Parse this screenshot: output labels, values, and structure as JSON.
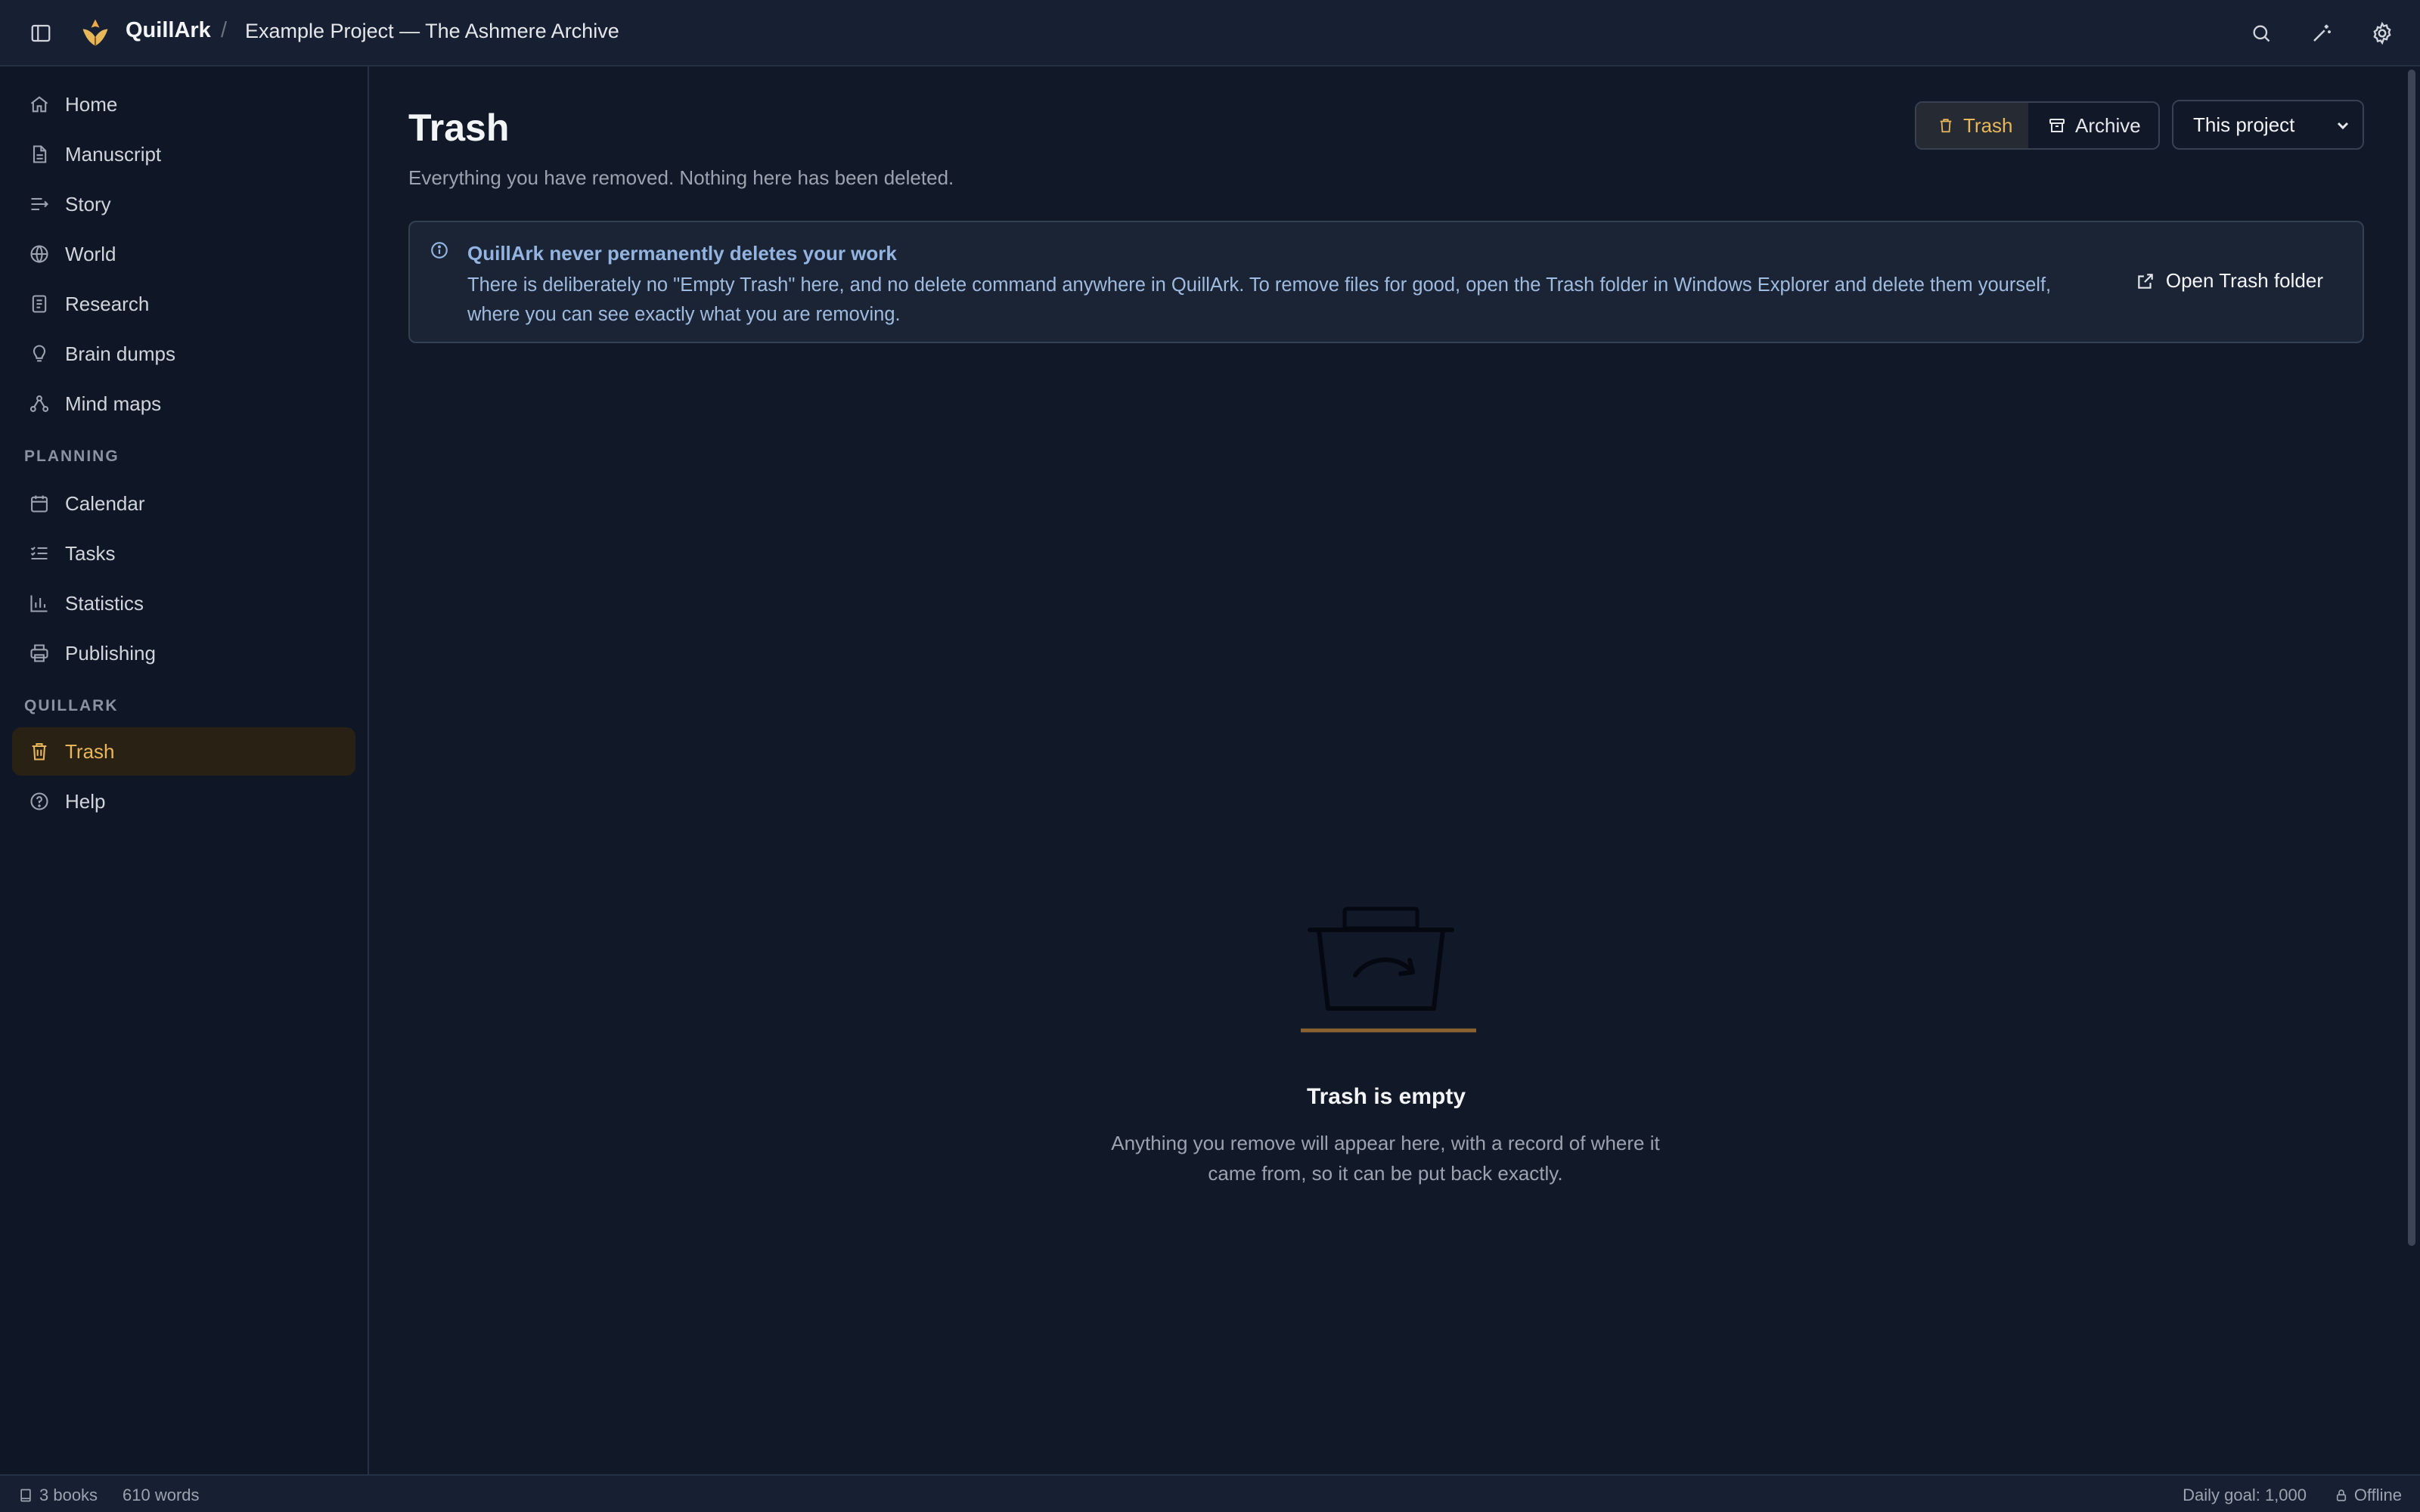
{
  "header": {
    "app_name": "QuillArk",
    "separator": "/",
    "project": "Example Project — The Ashmere Archive",
    "icons": [
      "sidebar-toggle-icon",
      "search-icon",
      "magic-wand-icon",
      "gear-icon"
    ]
  },
  "sidebar": {
    "items": [
      {
        "label": "Home",
        "icon": "home-icon"
      },
      {
        "label": "Manuscript",
        "icon": "document-icon"
      },
      {
        "label": "Story",
        "icon": "story-lines-icon"
      },
      {
        "label": "World",
        "icon": "globe-icon"
      },
      {
        "label": "Research",
        "icon": "notes-icon"
      },
      {
        "label": "Brain dumps",
        "icon": "lightbulb-icon"
      },
      {
        "label": "Mind maps",
        "icon": "mindmap-icon"
      }
    ],
    "planning_heading": "PLANNING",
    "planning_items": [
      {
        "label": "Calendar",
        "icon": "calendar-icon"
      },
      {
        "label": "Tasks",
        "icon": "tasks-icon"
      },
      {
        "label": "Statistics",
        "icon": "chart-icon"
      },
      {
        "label": "Publishing",
        "icon": "printer-icon"
      }
    ],
    "quillark_heading": "QUILLARK",
    "quillark_items": [
      {
        "label": "Trash",
        "icon": "trash-icon",
        "active": true
      },
      {
        "label": "Help",
        "icon": "help-icon"
      }
    ]
  },
  "main": {
    "title": "Trash",
    "subtitle": "Everything you have removed. Nothing here has been deleted.",
    "toggle": {
      "trash_label": "Trash",
      "archive_label": "Archive",
      "selected": "Trash"
    },
    "scope_select": {
      "value": "This project"
    },
    "info": {
      "title": "QuillArk never permanently deletes your work",
      "body": "There is deliberately no \"Empty Trash\" here, and no delete command anywhere in QuillArk. To remove files for good, open the Trash folder in Windows Explorer and delete them yourself, where you can see exactly what you are removing.",
      "action_label": "Open Trash folder"
    },
    "empty_state": {
      "title": "Trash is empty",
      "body": "Anything you remove will appear here, with a record of where it came from, so it can be put back exactly."
    }
  },
  "statusbar": {
    "books": "3 books",
    "words": "610 words",
    "daily_goal": "Daily goal: 1,000",
    "connection": "Offline"
  },
  "colors": {
    "accent": "#e8b75a",
    "background": "#111827",
    "sidebar_bg": "#0f1625",
    "info_text": "#93b4e0"
  }
}
